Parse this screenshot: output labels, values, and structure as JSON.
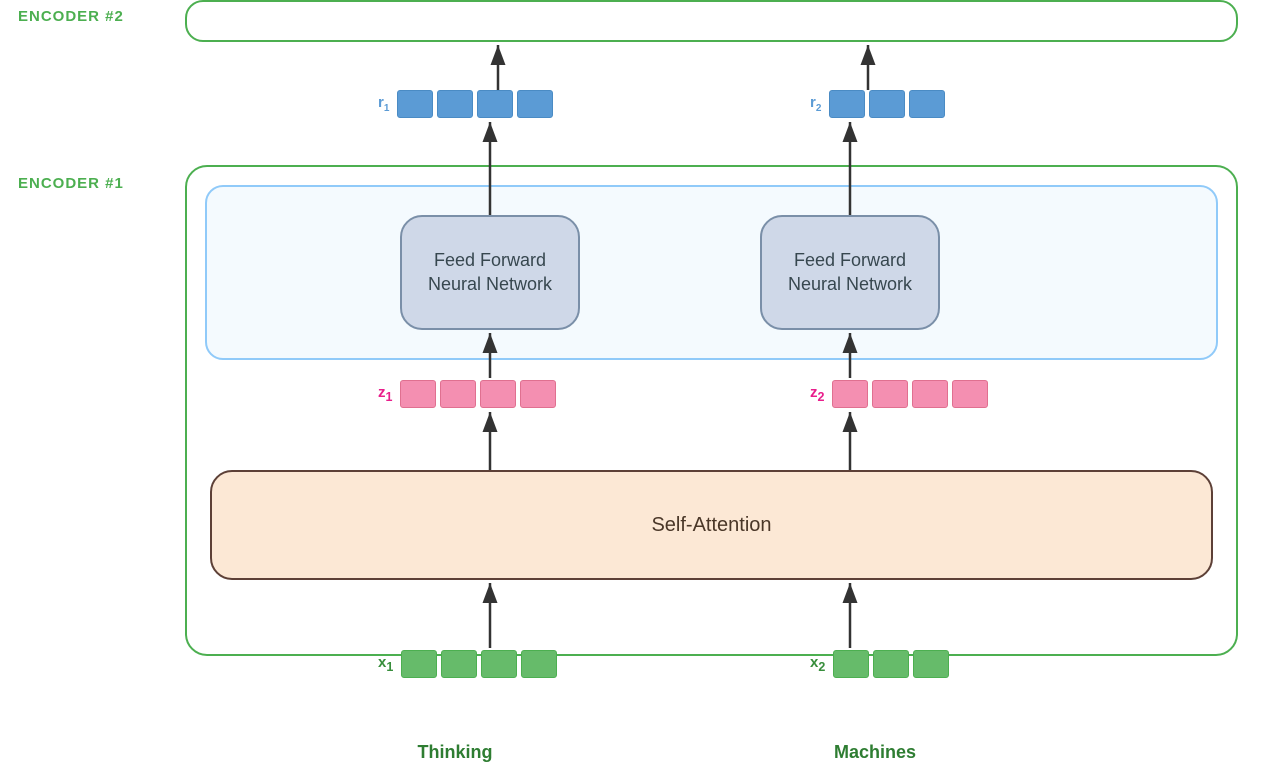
{
  "labels": {
    "encoder2": "ENCODER #2",
    "encoder1": "ENCODER #1",
    "ffnn1": "Feed Forward\nNeural Network",
    "ffnn2": "Feed Forward\nNeural Network",
    "self_attention": "Self-Attention",
    "thinking": "Thinking",
    "machines": "Machines",
    "r1": "r",
    "r1_sub": "1",
    "r2": "r",
    "r2_sub": "2",
    "z1": "z",
    "z1_sub": "1",
    "z2": "z",
    "z2_sub": "2",
    "x1": "x",
    "x1_sub": "1",
    "x2": "x",
    "x2_sub": "2"
  },
  "colors": {
    "green": "#4caf50",
    "green_dark": "#2e7d32",
    "blue": "#5b9bd5",
    "blue_light": "#90caf9",
    "pink": "#f48fb1",
    "pink_label": "#e91e8c",
    "green_block": "#66bb6a",
    "ffnn_bg": "#cfd8e8",
    "ffnn_border": "#7a8fa8",
    "sa_bg": "#fce8d5",
    "sa_border": "#5d4037"
  }
}
